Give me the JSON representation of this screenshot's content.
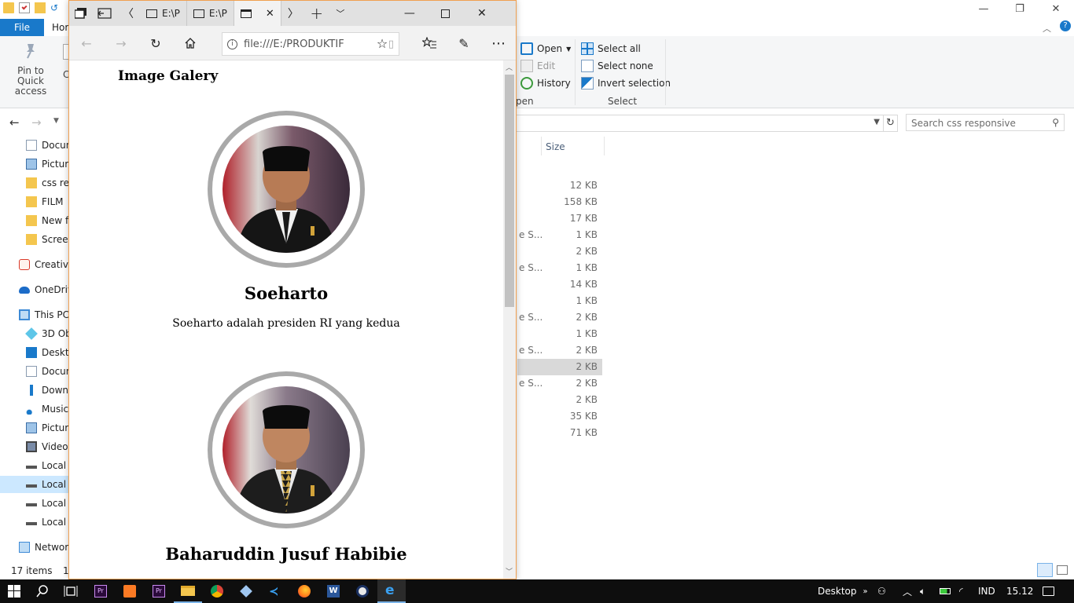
{
  "explorer": {
    "ribbon_tabs": {
      "file": "File",
      "home": "Hor"
    },
    "pin": {
      "label_line1": "Pin to Quick",
      "label_line2": "access"
    },
    "clip_letter": "C",
    "open_group": {
      "open": "Open",
      "edit": "Edit",
      "history": "History",
      "label": "pen"
    },
    "select_group": {
      "select_all": "Select all",
      "select_none": "Select none",
      "invert": "Invert selection",
      "label": "Select"
    },
    "search_placeholder": "Search css responsive",
    "nav": [
      {
        "label": "Docun",
        "icon": "document-icon",
        "indent": 1
      },
      {
        "label": "Picture",
        "icon": "pictures-icon",
        "indent": 1
      },
      {
        "label": "css res",
        "icon": "folder-icon",
        "indent": 1
      },
      {
        "label": "FILM",
        "icon": "folder-icon",
        "indent": 1
      },
      {
        "label": "New fo",
        "icon": "folder-icon",
        "indent": 1
      },
      {
        "label": "Screen",
        "icon": "folder-icon",
        "indent": 1
      },
      {
        "label": "Creative",
        "icon": "creative-cloud-icon",
        "indent": 0
      },
      {
        "label": "OneDriv",
        "icon": "onedrive-icon",
        "indent": 0
      },
      {
        "label": "This PC",
        "icon": "computer-icon",
        "indent": 0
      },
      {
        "label": "3D Obj",
        "icon": "3d-objects-icon",
        "indent": 1
      },
      {
        "label": "Deskto",
        "icon": "desktop-icon",
        "indent": 1
      },
      {
        "label": "Docun",
        "icon": "document-icon",
        "indent": 1
      },
      {
        "label": "Downl",
        "icon": "downloads-icon",
        "indent": 1
      },
      {
        "label": "Music",
        "icon": "music-icon",
        "indent": 1
      },
      {
        "label": "Picture",
        "icon": "pictures-icon",
        "indent": 1
      },
      {
        "label": "Videos",
        "icon": "videos-icon",
        "indent": 1
      },
      {
        "label": "Local D",
        "icon": "drive-icon",
        "indent": 1
      },
      {
        "label": "Local D",
        "icon": "drive-icon",
        "indent": 1
      },
      {
        "label": "Local D",
        "icon": "drive-icon",
        "indent": 1
      },
      {
        "label": "Local D",
        "icon": "drive-icon",
        "indent": 1
      },
      {
        "label": "Network",
        "icon": "network-icon",
        "indent": 0
      }
    ],
    "selected_nav_index": 17,
    "size_header": "Size",
    "files": [
      {
        "type": "",
        "size": "12 KB"
      },
      {
        "type": "",
        "size": "158 KB"
      },
      {
        "type": "",
        "size": "17 KB"
      },
      {
        "type": "e S...",
        "size": "1 KB"
      },
      {
        "type": "",
        "size": "2 KB"
      },
      {
        "type": "e S...",
        "size": "1 KB"
      },
      {
        "type": "",
        "size": "14 KB"
      },
      {
        "type": "",
        "size": "1 KB"
      },
      {
        "type": "e S...",
        "size": "2 KB"
      },
      {
        "type": "",
        "size": "1 KB"
      },
      {
        "type": "e S...",
        "size": "2 KB"
      },
      {
        "type": "",
        "size": "2 KB"
      },
      {
        "type": "e S...",
        "size": "2 KB"
      },
      {
        "type": "",
        "size": "2 KB"
      },
      {
        "type": "",
        "size": "35 KB"
      },
      {
        "type": "",
        "size": "71 KB"
      }
    ],
    "highlighted_row": 11,
    "status": {
      "items": "17 items",
      "extra": "1"
    }
  },
  "edge": {
    "tabs": [
      {
        "label": "E:\\P",
        "active": false
      },
      {
        "label": "E:\\P",
        "active": false
      },
      {
        "label": "",
        "active": true
      }
    ],
    "url": "file:///E:/PRODUKTIF",
    "page": {
      "title": "Image Galery",
      "people": [
        {
          "name": "Soeharto",
          "desc": "Soeharto adalah presiden RI yang kedua",
          "tie": "dark"
        },
        {
          "name": "Baharuddin Jusuf Habibie",
          "desc": "",
          "tie": "pattern"
        }
      ]
    }
  },
  "taskbar": {
    "apps": [
      "premiere-icon",
      "xampp-icon",
      "premiere-icon",
      "file-explorer-icon",
      "chrome-icon",
      "box-icon",
      "vscode-icon",
      "firefox-icon",
      "word-icon",
      "obs-icon",
      "edge-icon"
    ],
    "active_app": 10,
    "desktop_label": "Desktop",
    "lang": "IND",
    "time": "15.12"
  },
  "colors": {
    "accent": "#1979ca",
    "edge_border": "#f0a050",
    "taskbar": "#0e0e0e"
  }
}
